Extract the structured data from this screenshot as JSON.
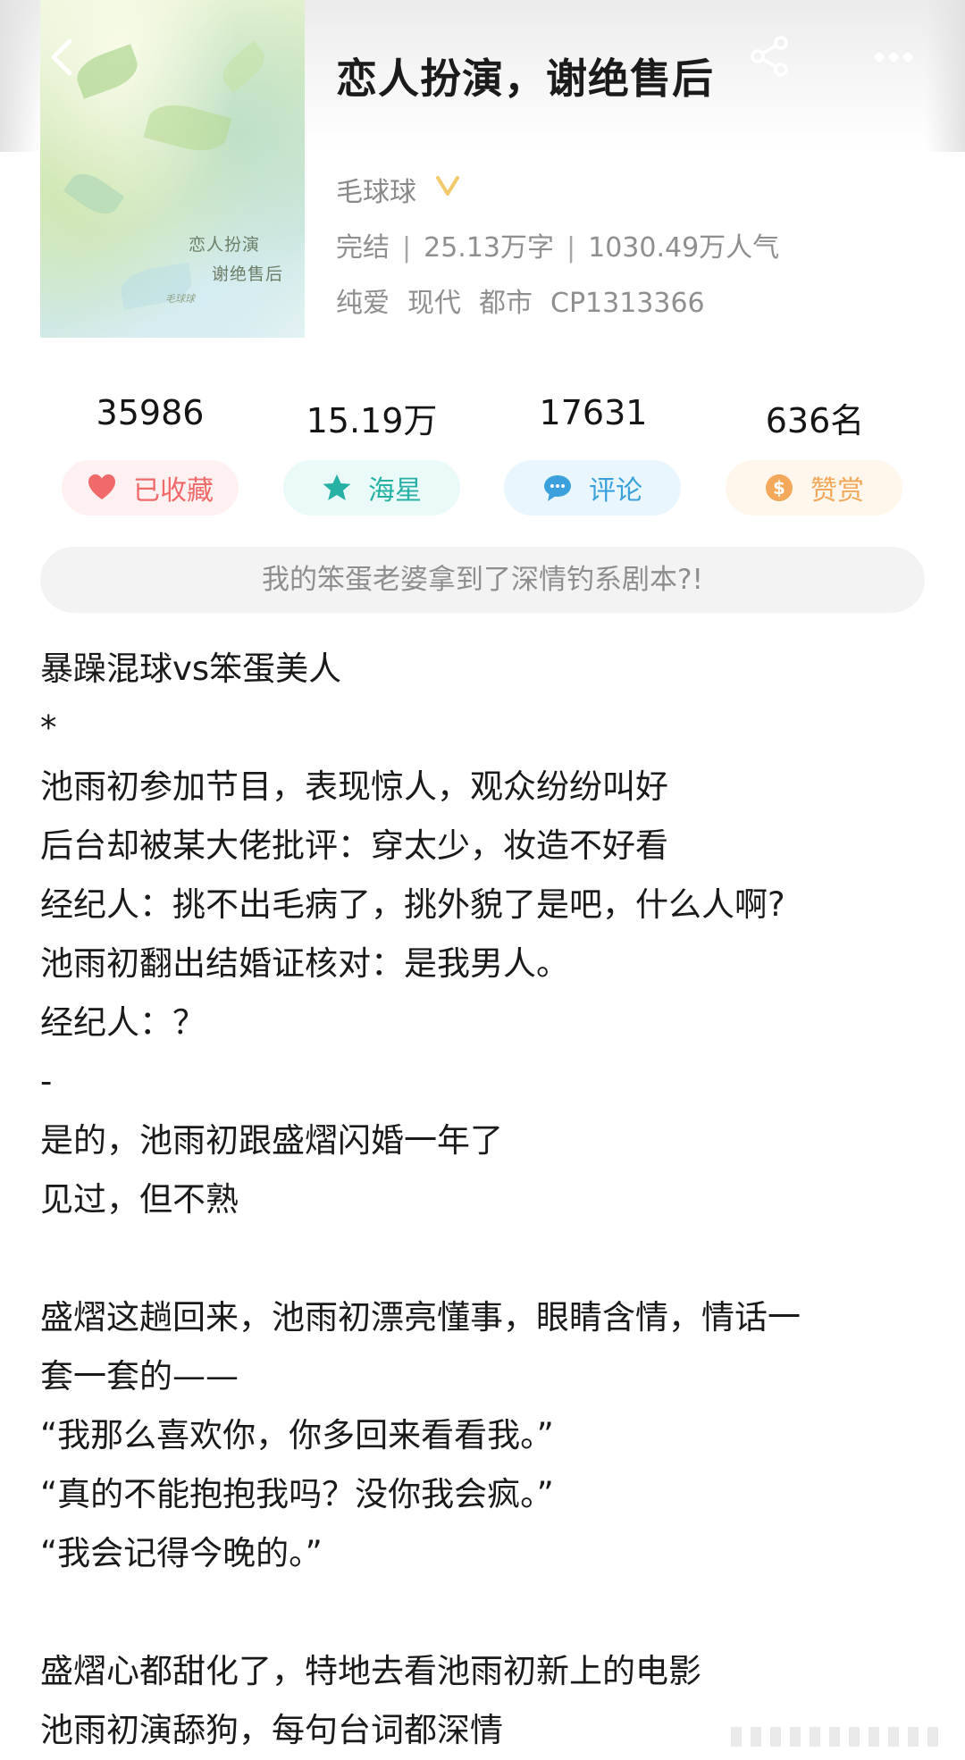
{
  "book": {
    "title": "恋人扮演，谢绝售后",
    "cover_title_line1": "恋人扮演",
    "cover_title_line2": "谢绝售后",
    "cover_signature": "毛球球",
    "author": "毛球球",
    "status": "完结",
    "word_count": "25.13万字",
    "popularity": "1030.49万人气",
    "tags": [
      "纯爱",
      "现代",
      "都市",
      "CP1313366"
    ]
  },
  "stats": [
    "35986",
    "15.19万",
    "17631",
    "636名"
  ],
  "actions": {
    "favorite": "已收藏",
    "starfish": "海星",
    "comment": "评论",
    "tip": "赞赏"
  },
  "tagline": "我的笨蛋老婆拿到了深情钓系剧本?!",
  "intro": [
    "暴躁混球vs笨蛋美人",
    "*",
    "池雨初参加节目，表现惊人，观众纷纷叫好",
    "后台却被某大佬批评：穿太少，妆造不好看",
    "经纪人：挑不出毛病了，挑外貌了是吧，什么人啊?",
    "池雨初翻出结婚证核对：是我男人。",
    "经纪人：？",
    "-",
    "是的，池雨初跟盛熠闪婚一年了",
    "见过，但不熟",
    "",
    "盛熠这趟回来，池雨初漂亮懂事，眼睛含情，情话一",
    "套一套的——",
    "“我那么喜欢你，你多回来看看我。”",
    "“真的不能抱抱我吗？没你我会疯。”",
    "“我会记得今晚的。”",
    "",
    "盛熠心都甜化了，特地去看池雨初新上的电影",
    "池雨初演舔狗，每句台词都深情"
  ],
  "colors": {
    "favorite": "#f06a6a",
    "starfish": "#27b0a4",
    "comment": "#3aa1dc",
    "tip": "#f3a85a",
    "vip": "#f2c96a"
  },
  "icons": [
    "back-icon",
    "share-icon",
    "more-icon",
    "vip-badge-icon",
    "heart-icon",
    "star-icon",
    "comment-icon",
    "coin-icon"
  ]
}
